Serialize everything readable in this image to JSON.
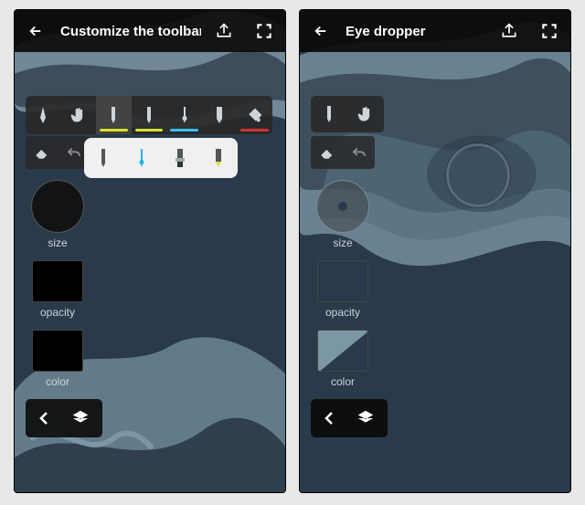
{
  "left": {
    "title": "Customize the toolbar",
    "toolbar": [
      {
        "icon": "pen",
        "accent": ""
      },
      {
        "icon": "hand",
        "accent": ""
      },
      {
        "icon": "pencil",
        "accent": "#d8e22e"
      },
      {
        "icon": "pencil2",
        "accent": "#d8e22e"
      },
      {
        "icon": "brush",
        "accent": "#39c0ff"
      },
      {
        "icon": "marker",
        "accent": ""
      },
      {
        "icon": "bucket",
        "accent": "#d23232"
      }
    ],
    "popover": [
      "pencil",
      "ink-brush",
      "flat-brush",
      "marker"
    ],
    "labels": {
      "size": "size",
      "opacity": "opacity",
      "color": "color"
    }
  },
  "right": {
    "title": "Eye dropper",
    "labels": {
      "size": "size",
      "opacity": "opacity",
      "color": "color"
    },
    "sample_color": "#2a3a4a",
    "sample_color2": "#7c97a4"
  },
  "colors": {
    "bg": "#2a3a4a",
    "art_light": "#7c97a4",
    "art_dark": "#1b2733"
  }
}
